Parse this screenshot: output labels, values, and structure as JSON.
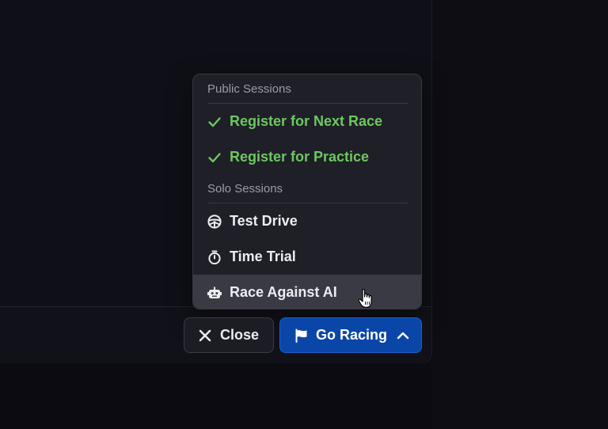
{
  "menu": {
    "sections": [
      {
        "header": "Public Sessions",
        "items": [
          {
            "label": "Register for Next Race",
            "icon": "check-icon",
            "checked": true
          },
          {
            "label": "Register for Practice",
            "icon": "check-icon",
            "checked": true
          }
        ]
      },
      {
        "header": "Solo Sessions",
        "items": [
          {
            "label": "Test Drive",
            "icon": "steering-wheel-icon",
            "checked": false
          },
          {
            "label": "Time Trial",
            "icon": "stopwatch-icon",
            "checked": false
          },
          {
            "label": "Race Against AI",
            "icon": "robot-icon",
            "checked": false,
            "hovered": true
          }
        ]
      }
    ]
  },
  "footer": {
    "close_label": "Close",
    "close_icon": "x-icon",
    "go_racing_label": "Go Racing",
    "go_racing_icon": "flag-icon",
    "go_racing_chevron": "chevron-up-icon"
  },
  "colors": {
    "checked_text": "#6cc860",
    "primary_button": "#0a46a8",
    "menu_background": "#1f1f27",
    "hover_background": "#3a3a44"
  }
}
